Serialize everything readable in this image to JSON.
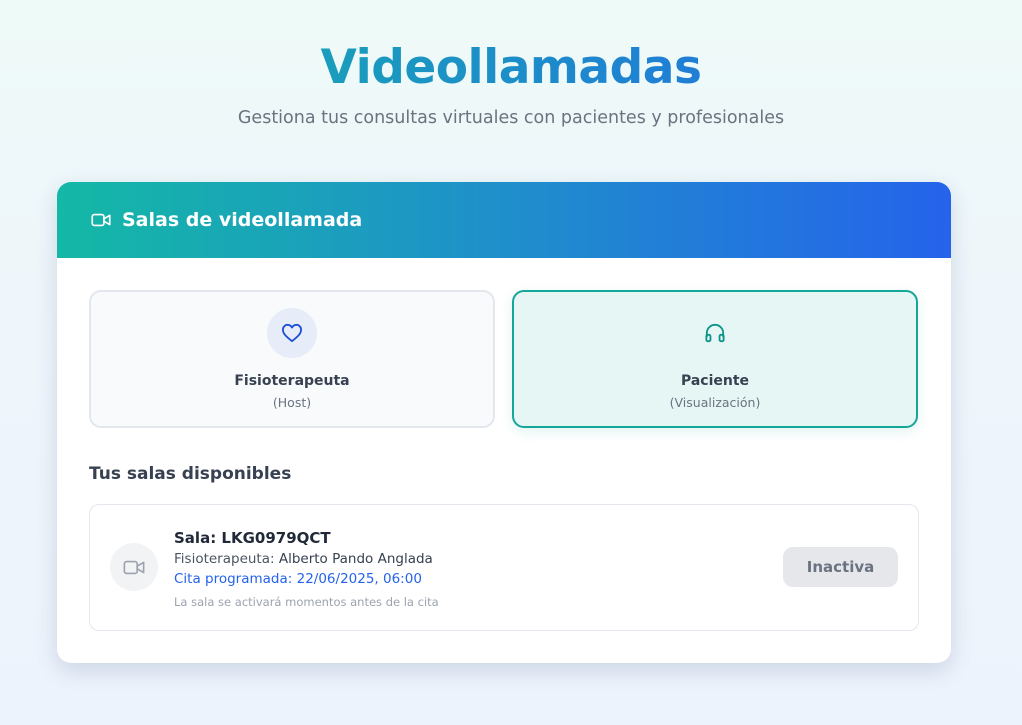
{
  "header": {
    "title": "Videollamadas",
    "subtitle": "Gestiona tus consultas virtuales con pacientes y profesionales"
  },
  "card": {
    "title": "Salas de videollamada",
    "title_icon": "video-icon"
  },
  "roles": [
    {
      "name": "Fisioterapeuta",
      "sub": "(Host)",
      "icon": "heart-icon",
      "selected": false
    },
    {
      "name": "Paciente",
      "sub": "(Visualización)",
      "icon": "headphones-icon",
      "selected": true
    }
  ],
  "rooms_section": {
    "title": "Tus salas disponibles",
    "rooms": [
      {
        "room_label": "Sala: LKG0979QCT",
        "physio_label": "Fisioterapeuta: ",
        "physio_name": "Alberto Pando Anglada",
        "scheduled": "Cita programada: 22/06/2025, 06:00",
        "note": "La sala se activará momentos antes de la cita",
        "status": "Inactiva",
        "icon": "video-icon"
      }
    ]
  },
  "colors": {
    "teal": "#14b8a6",
    "blue": "#2563eb",
    "selected_border": "#14a697"
  }
}
